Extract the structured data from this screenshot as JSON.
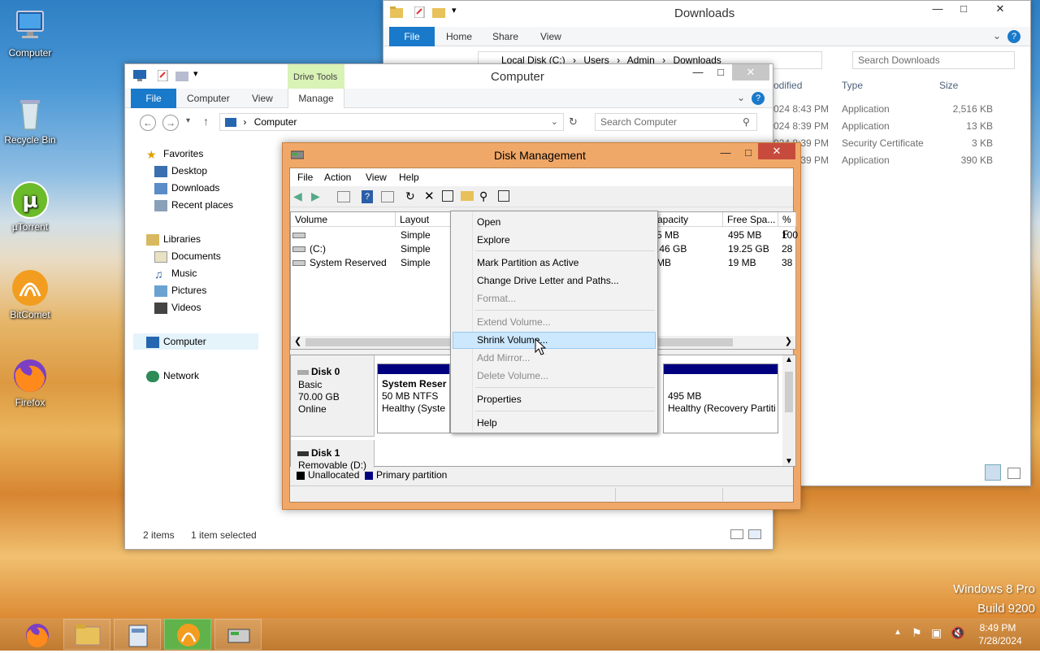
{
  "desktop": {
    "icons": [
      {
        "label": "Computer"
      },
      {
        "label": "Recycle Bin"
      },
      {
        "label": "µTorrent"
      },
      {
        "label": "BitComet"
      },
      {
        "label": "Firefox"
      }
    ],
    "watermark": {
      "line1": "Windows 8 Pro",
      "line2": "Build 9200"
    }
  },
  "downloads_window": {
    "title": "Downloads",
    "tabs": [
      "File",
      "Home",
      "Share",
      "View"
    ],
    "path": [
      "Local Disk (C:)",
      "Users",
      "Admin",
      "Downloads"
    ],
    "search_placeholder": "Search Downloads",
    "columns": [
      "odified",
      "Type",
      "Size"
    ],
    "rows": [
      {
        "modified": "024 8:43 PM",
        "type": "Application",
        "size": "2,516 KB"
      },
      {
        "modified": "024 8:39 PM",
        "type": "Application",
        "size": "13 KB"
      },
      {
        "modified": "024 8:39 PM",
        "type": "Security Certificate",
        "size": "3 KB"
      },
      {
        "modified": "024 8:39 PM",
        "type": "Application",
        "size": "390 KB"
      }
    ]
  },
  "computer_window": {
    "title": "Computer",
    "context_tab": "Drive Tools",
    "tabs": [
      "File",
      "Computer",
      "View",
      "Manage"
    ],
    "address": "Computer",
    "search_placeholder": "Search Computer",
    "nav": {
      "favorites": "Favorites",
      "favorites_items": [
        "Desktop",
        "Downloads",
        "Recent places"
      ],
      "libraries": "Libraries",
      "libraries_items": [
        "Documents",
        "Music",
        "Pictures",
        "Videos"
      ],
      "computer": "Computer",
      "network": "Network"
    },
    "status": {
      "items": "2 items",
      "selected": "1 item selected"
    }
  },
  "disk_mgmt": {
    "title": "Disk Management",
    "menu": [
      "File",
      "Action",
      "View",
      "Help"
    ],
    "columns": [
      "Volume",
      "Layout",
      "apacity",
      "Free Spa...",
      "% F"
    ],
    "rows": [
      {
        "volume": "",
        "layout": "Simple",
        "capacity": "5 MB",
        "free": "495 MB",
        "pct": "100"
      },
      {
        "volume": "(C:)",
        "layout": "Simple",
        "capacity": ".46 GB",
        "free": "19.25 GB",
        "pct": "28"
      },
      {
        "volume": "System Reserved",
        "layout": "Simple",
        "capacity": "MB",
        "free": "19 MB",
        "pct": "38"
      }
    ],
    "disk0": {
      "name": "Disk 0",
      "type": "Basic",
      "size": "70.00 GB",
      "state": "Online"
    },
    "part_sys": {
      "name": "System Reser",
      "size": "50 MB NTFS",
      "health": "Healthy (Syste"
    },
    "part_rec": {
      "size": "495 MB",
      "health": "Healthy (Recovery Partiti"
    },
    "disk1": {
      "name": "Disk 1",
      "type": "Removable (D:)"
    },
    "legend": {
      "unallocated": "Unallocated",
      "primary": "Primary partition"
    }
  },
  "context_menu": {
    "items": [
      {
        "label": "Open",
        "disabled": false
      },
      {
        "label": "Explore",
        "disabled": false
      },
      {
        "label": "Mark Partition as Active",
        "disabled": false
      },
      {
        "label": "Change Drive Letter and Paths...",
        "disabled": false
      },
      {
        "label": "Format...",
        "disabled": true
      },
      {
        "label": "Extend Volume...",
        "disabled": true
      },
      {
        "label": "Shrink Volume...",
        "disabled": false
      },
      {
        "label": "Add Mirror...",
        "disabled": true
      },
      {
        "label": "Delete Volume...",
        "disabled": true
      },
      {
        "label": "Properties",
        "disabled": false
      },
      {
        "label": "Help",
        "disabled": false
      }
    ],
    "highlighted": "Shrink Volume..."
  },
  "taskbar": {
    "time": "8:49 PM",
    "date": "7/28/2024"
  },
  "colors": {
    "accent": "#1979ca",
    "dm_frame": "#f0a868",
    "partition_bar": "#00007f",
    "highlight": "#cce8ff"
  }
}
